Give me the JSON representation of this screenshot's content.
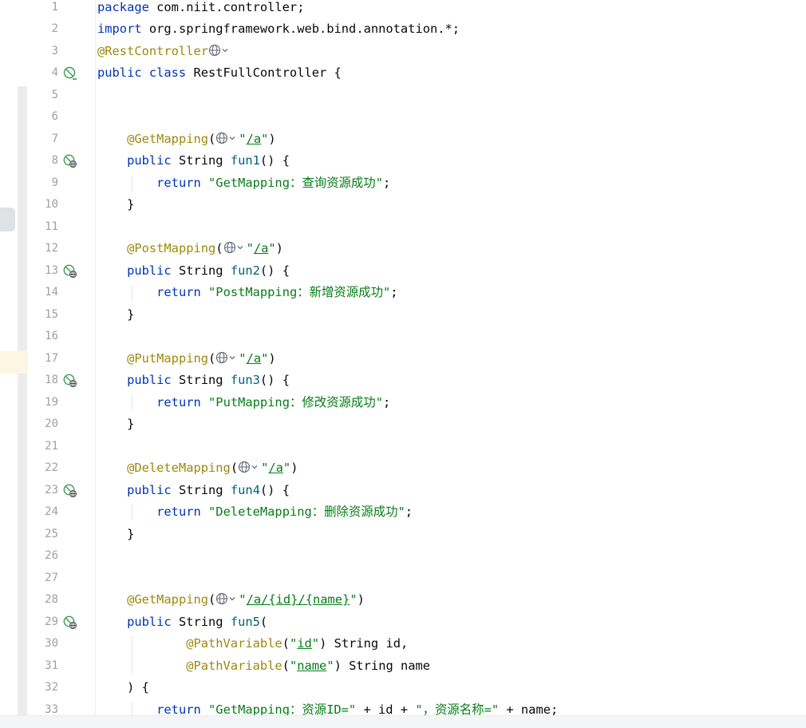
{
  "editor": {
    "lines": [
      {
        "n": "1",
        "parts": [
          {
            "t": "package",
            "c": "kw"
          },
          {
            "t": " com.niit.controller;",
            "c": ""
          }
        ]
      },
      {
        "n": "2",
        "parts": [
          {
            "t": "import",
            "c": "kw"
          },
          {
            "t": " org.springframework.web.bind.annotation.*;",
            "c": ""
          }
        ]
      },
      {
        "n": "3",
        "parts": [
          {
            "t": "@RestController",
            "c": "ann"
          },
          {
            "globe": true
          }
        ]
      },
      {
        "n": "4",
        "icon": "no-mapping-icon",
        "parts": [
          {
            "t": "public class",
            "c": "kw"
          },
          {
            "t": " RestFullController {",
            "c": ""
          }
        ]
      },
      {
        "n": "5",
        "parts": []
      },
      {
        "n": "6",
        "parts": []
      },
      {
        "n": "7",
        "parts": [
          {
            "t": "    ",
            "c": ""
          },
          {
            "t": "@GetMapping",
            "c": "ann"
          },
          {
            "t": "(",
            "c": ""
          },
          {
            "globe": true
          },
          {
            "t": "\"",
            "c": "str"
          },
          {
            "t": "/a",
            "c": "str url"
          },
          {
            "t": "\"",
            "c": "str"
          },
          {
            "t": ")",
            "c": ""
          }
        ]
      },
      {
        "n": "8",
        "icon": "endpoint-icon",
        "parts": [
          {
            "t": "    ",
            "c": ""
          },
          {
            "t": "public",
            "c": "kw"
          },
          {
            "t": " String ",
            "c": ""
          },
          {
            "t": "fun1",
            "c": "fn"
          },
          {
            "t": "() {",
            "c": ""
          }
        ]
      },
      {
        "n": "9",
        "parts": [
          {
            "t": "        ",
            "c": ""
          },
          {
            "t": "return",
            "c": "kw"
          },
          {
            "t": " ",
            "c": ""
          },
          {
            "t": "\"GetMapping：查询资源成功\"",
            "c": "str"
          },
          {
            "t": ";",
            "c": ""
          }
        ]
      },
      {
        "n": "10",
        "parts": [
          {
            "t": "    }",
            "c": ""
          }
        ]
      },
      {
        "n": "11",
        "parts": []
      },
      {
        "n": "12",
        "parts": [
          {
            "t": "    ",
            "c": ""
          },
          {
            "t": "@PostMapping",
            "c": "ann"
          },
          {
            "t": "(",
            "c": ""
          },
          {
            "globe": true
          },
          {
            "t": "\"",
            "c": "str"
          },
          {
            "t": "/a",
            "c": "str url"
          },
          {
            "t": "\"",
            "c": "str"
          },
          {
            "t": ")",
            "c": ""
          }
        ]
      },
      {
        "n": "13",
        "icon": "endpoint-icon",
        "parts": [
          {
            "t": "    ",
            "c": ""
          },
          {
            "t": "public",
            "c": "kw"
          },
          {
            "t": " String ",
            "c": ""
          },
          {
            "t": "fun2",
            "c": "fn"
          },
          {
            "t": "() {",
            "c": ""
          }
        ]
      },
      {
        "n": "14",
        "parts": [
          {
            "t": "        ",
            "c": ""
          },
          {
            "t": "return",
            "c": "kw"
          },
          {
            "t": " ",
            "c": ""
          },
          {
            "t": "\"PostMapping：新增资源成功\"",
            "c": "str"
          },
          {
            "t": ";",
            "c": ""
          }
        ]
      },
      {
        "n": "15",
        "parts": [
          {
            "t": "    }",
            "c": ""
          }
        ]
      },
      {
        "n": "16",
        "parts": []
      },
      {
        "n": "17",
        "parts": [
          {
            "t": "    ",
            "c": ""
          },
          {
            "t": "@PutMapping",
            "c": "ann"
          },
          {
            "t": "(",
            "c": ""
          },
          {
            "globe": true
          },
          {
            "t": "\"",
            "c": "str"
          },
          {
            "t": "/a",
            "c": "str url"
          },
          {
            "t": "\"",
            "c": "str"
          },
          {
            "t": ")",
            "c": ""
          }
        ]
      },
      {
        "n": "18",
        "icon": "endpoint-icon",
        "parts": [
          {
            "t": "    ",
            "c": ""
          },
          {
            "t": "public",
            "c": "kw"
          },
          {
            "t": " String ",
            "c": ""
          },
          {
            "t": "fun3",
            "c": "fn"
          },
          {
            "t": "() {",
            "c": ""
          }
        ]
      },
      {
        "n": "19",
        "parts": [
          {
            "t": "        ",
            "c": ""
          },
          {
            "t": "return",
            "c": "kw"
          },
          {
            "t": " ",
            "c": ""
          },
          {
            "t": "\"PutMapping：修改资源成功\"",
            "c": "str"
          },
          {
            "t": ";",
            "c": ""
          }
        ]
      },
      {
        "n": "20",
        "parts": [
          {
            "t": "    }",
            "c": ""
          }
        ]
      },
      {
        "n": "21",
        "parts": []
      },
      {
        "n": "22",
        "parts": [
          {
            "t": "    ",
            "c": ""
          },
          {
            "t": "@DeleteMapping",
            "c": "ann"
          },
          {
            "t": "(",
            "c": ""
          },
          {
            "globe": true
          },
          {
            "t": "\"",
            "c": "str"
          },
          {
            "t": "/a",
            "c": "str url"
          },
          {
            "t": "\"",
            "c": "str"
          },
          {
            "t": ")",
            "c": ""
          }
        ]
      },
      {
        "n": "23",
        "icon": "endpoint-icon",
        "parts": [
          {
            "t": "    ",
            "c": ""
          },
          {
            "t": "public",
            "c": "kw"
          },
          {
            "t": " String ",
            "c": ""
          },
          {
            "t": "fun4",
            "c": "fn"
          },
          {
            "t": "() {",
            "c": ""
          }
        ]
      },
      {
        "n": "24",
        "parts": [
          {
            "t": "        ",
            "c": ""
          },
          {
            "t": "return",
            "c": "kw"
          },
          {
            "t": " ",
            "c": ""
          },
          {
            "t": "\"DeleteMapping：删除资源成功\"",
            "c": "str"
          },
          {
            "t": ";",
            "c": ""
          }
        ]
      },
      {
        "n": "25",
        "parts": [
          {
            "t": "    }",
            "c": ""
          }
        ]
      },
      {
        "n": "26",
        "parts": []
      },
      {
        "n": "27",
        "parts": []
      },
      {
        "n": "28",
        "parts": [
          {
            "t": "    ",
            "c": ""
          },
          {
            "t": "@GetMapping",
            "c": "ann"
          },
          {
            "t": "(",
            "c": ""
          },
          {
            "globe": true
          },
          {
            "t": "\"",
            "c": "str"
          },
          {
            "t": "/a/{id}/{name}",
            "c": "str url"
          },
          {
            "t": "\"",
            "c": "str"
          },
          {
            "t": ")",
            "c": ""
          }
        ]
      },
      {
        "n": "29",
        "icon": "endpoint-icon",
        "parts": [
          {
            "t": "    ",
            "c": ""
          },
          {
            "t": "public",
            "c": "kw"
          },
          {
            "t": " String ",
            "c": ""
          },
          {
            "t": "fun5",
            "c": "fn"
          },
          {
            "t": "(",
            "c": ""
          }
        ]
      },
      {
        "n": "30",
        "parts": [
          {
            "t": "            ",
            "c": ""
          },
          {
            "t": "@PathVariable",
            "c": "ann"
          },
          {
            "t": "(",
            "c": ""
          },
          {
            "t": "\"",
            "c": "str"
          },
          {
            "t": "id",
            "c": "str url"
          },
          {
            "t": "\"",
            "c": "str"
          },
          {
            "t": ") String id,",
            "c": ""
          }
        ]
      },
      {
        "n": "31",
        "parts": [
          {
            "t": "            ",
            "c": ""
          },
          {
            "t": "@PathVariable",
            "c": "ann"
          },
          {
            "t": "(",
            "c": ""
          },
          {
            "t": "\"",
            "c": "str"
          },
          {
            "t": "name",
            "c": "str url"
          },
          {
            "t": "\"",
            "c": "str"
          },
          {
            "t": ") String name",
            "c": ""
          }
        ]
      },
      {
        "n": "32",
        "parts": [
          {
            "t": "    ) {",
            "c": ""
          }
        ]
      },
      {
        "n": "33",
        "parts": [
          {
            "t": "        ",
            "c": ""
          },
          {
            "t": "return",
            "c": "kw"
          },
          {
            "t": " ",
            "c": ""
          },
          {
            "t": "\"GetMapping：资源ID=\"",
            "c": "str"
          },
          {
            "t": " + id + ",
            "c": ""
          },
          {
            "t": "\"，资源名称=\"",
            "c": "str"
          },
          {
            "t": " + name;",
            "c": ""
          }
        ]
      }
    ]
  },
  "colors": {
    "keyword": "#0033b3",
    "annotation": "#9e880d",
    "string": "#067d17",
    "method": "#00627a",
    "line_number": "#9ea0a6",
    "gutter_icon": "#3d9a4f"
  }
}
